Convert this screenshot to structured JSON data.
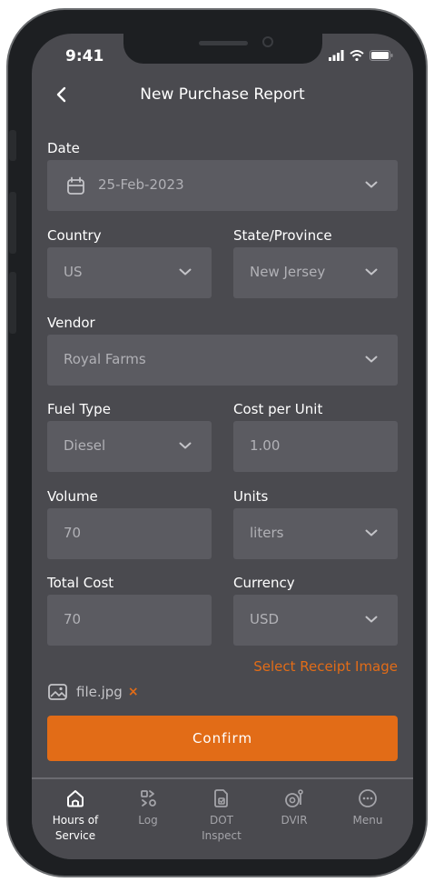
{
  "status_bar": {
    "time": "9:41"
  },
  "header": {
    "title": "New Purchase Report"
  },
  "form": {
    "date_label": "Date",
    "date_value": "25-Feb-2023",
    "country_label": "Country",
    "country_value": "US",
    "state_label": "State/Province",
    "state_value": "New Jersey",
    "vendor_label": "Vendor",
    "vendor_value": "Royal Farms",
    "fuel_type_label": "Fuel Type",
    "fuel_type_value": "Diesel",
    "cost_label": "Cost per Unit",
    "cost_value": "1.00",
    "volume_label": "Volume",
    "volume_value": "70",
    "units_label": "Units",
    "units_value": "liters",
    "total_label": "Total Cost",
    "total_value": "70",
    "currency_label": "Currency",
    "currency_value": "USD",
    "receipt_link": "Select Receipt Image",
    "file_name": "file.jpg",
    "file_remove": "×",
    "confirm_label": "Confirm"
  },
  "tabbar": {
    "hours_line1": "Hours of",
    "hours_line2": "Service",
    "log": "Log",
    "dot_line1": "DOT",
    "dot_line2": "Inspect",
    "dvir": "DVIR",
    "menu": "Menu"
  },
  "colors": {
    "accent": "#e26c17",
    "screen_bg": "#4a4a4f",
    "field_bg": "#5b5b61"
  },
  "icons": {
    "back": "chevron-left-icon",
    "calendar": "calendar-icon",
    "dropdown": "chevron-down-icon",
    "image": "image-icon",
    "tabs": [
      "home-icon",
      "log-icon",
      "inspect-icon",
      "dvir-icon",
      "menu-icon"
    ]
  }
}
